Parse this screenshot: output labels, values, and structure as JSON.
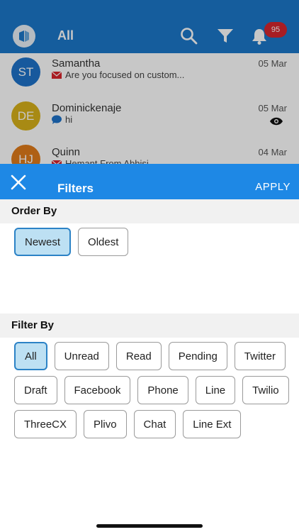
{
  "appbar": {
    "title": "All",
    "badge_count": "95"
  },
  "conversations": [
    {
      "initials": "ST",
      "name": "Samantha",
      "date": "05 Mar",
      "preview": "Are you focused on custom...",
      "channel_icon": "email-icon",
      "avatar_color": "#1e73c9"
    },
    {
      "initials": "DE",
      "name": "Dominickenaje",
      "date": "05 Mar",
      "preview": "hi",
      "channel_icon": "chat-icon",
      "avatar_color": "#d8b11a",
      "seen_icon": "eye-icon"
    },
    {
      "initials": "HJ",
      "name": "Quinn",
      "date": "04 Mar",
      "preview": "Hemant From Abhisi...",
      "channel_icon": "email-icon",
      "avatar_color": "#e07b1a"
    }
  ],
  "filters": {
    "title": "Filters",
    "apply_label": "APPLY",
    "order_by": {
      "label": "Order By",
      "options": [
        "Newest",
        "Oldest"
      ],
      "selected": "Newest"
    },
    "filter_by": {
      "label": "Filter By",
      "options": [
        "All",
        "Unread",
        "Read",
        "Pending",
        "Twitter",
        "Draft",
        "Facebook",
        "Phone",
        "Line",
        "Twilio",
        "ThreeCX",
        "Plivo",
        "Chat",
        "Line Ext"
      ],
      "selected": "All"
    }
  },
  "colors": {
    "appbar": "#1b78c9",
    "sheet_header": "#1e88e5",
    "selected_chip": "#bde0f3",
    "badge": "#d7262e"
  }
}
